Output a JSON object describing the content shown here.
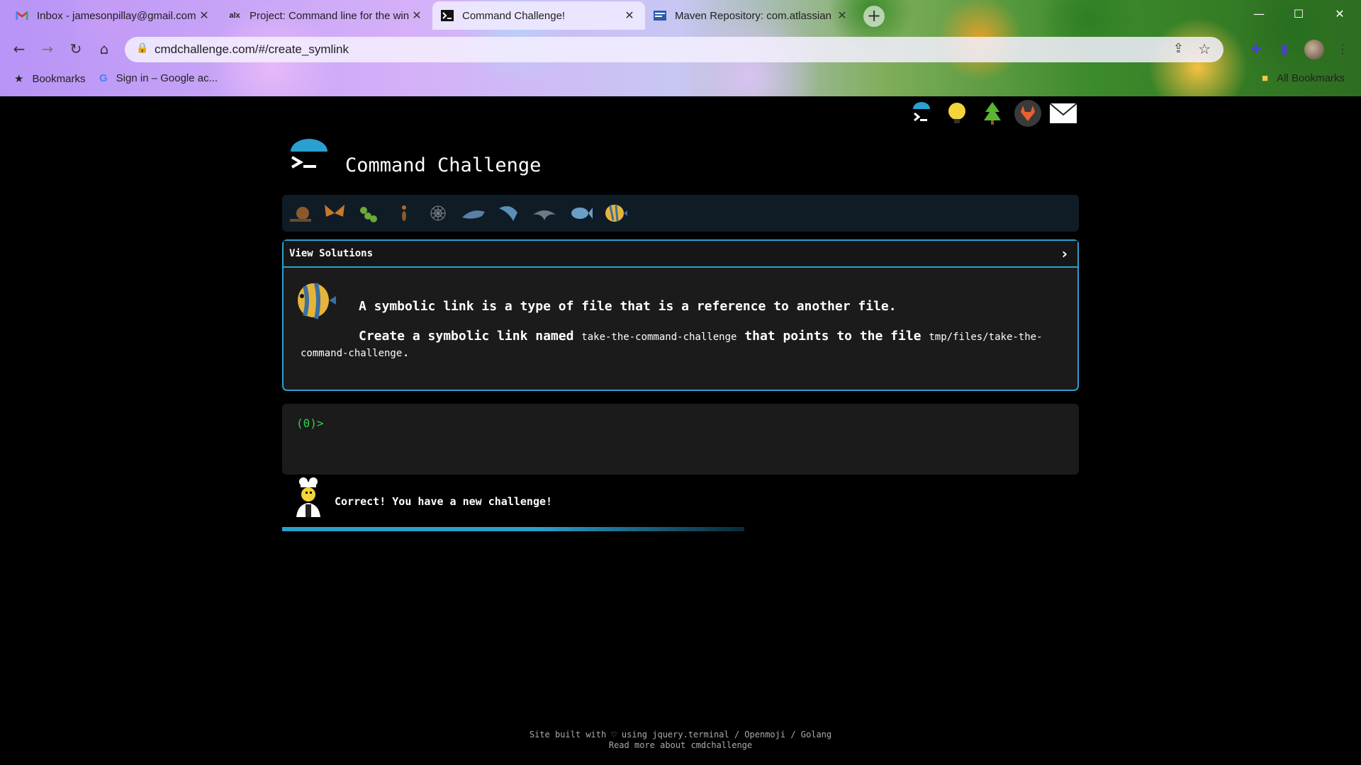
{
  "browser": {
    "tabs": [
      {
        "title": "Inbox - jamesonpillay@gmail.com",
        "favicon": "gmail-icon",
        "active": false
      },
      {
        "title": "Project: Command line for the win",
        "favicon": "alx-icon",
        "active": false
      },
      {
        "title": "Command Challenge!",
        "favicon": "terminal-icon",
        "active": true
      },
      {
        "title": "Maven Repository: com.atlassian",
        "favicon": "maven-icon",
        "active": false
      }
    ],
    "url": "cmdchallenge.com/#/create_symlink",
    "bookmarks": {
      "bookmarks_label": "Bookmarks",
      "google_signin": "Sign in – Google ac...",
      "all_bookmarks": "All Bookmarks"
    },
    "colors": {
      "active_tab": "#eee8ff",
      "accent": "#4b3fd1"
    }
  },
  "site": {
    "title": "Command Challenge",
    "view_solutions": "View Solutions",
    "description_line1": "A symbolic link is a type of file that is a reference to another file.",
    "description_line2_a": "Create a symbolic link named ",
    "description_code1": "take-the-command-challenge",
    "description_line2_b": " that points to the file ",
    "description_code2": "tmp/files/take-the-command-challenge",
    "description_end": ".",
    "prompt": "(0)>",
    "status_message": "Correct! You have a new challenge!",
    "progress_fraction": 0.58,
    "footer_line1": "Site built with ♡ using jquery.terminal / Openmoji / Golang",
    "footer_line2": "Read more about cmdchallenge",
    "level_icons": [
      "snail-icon",
      "butterfly-icon",
      "caterpillar-icon",
      "ant-icon",
      "spider-web-icon",
      "shark-icon",
      "dolphin-icon",
      "dolphin-grey-icon",
      "fish-icon",
      "tropical-fish-icon"
    ],
    "top_icons": [
      "terminal-logo-icon",
      "hint-bulb-icon",
      "tree-icon",
      "gitlab-icon",
      "mail-icon"
    ],
    "colors": {
      "accent": "#2aa0d0",
      "prompt_green": "#35d14c",
      "panel_bg": "#1b1b1b"
    }
  }
}
